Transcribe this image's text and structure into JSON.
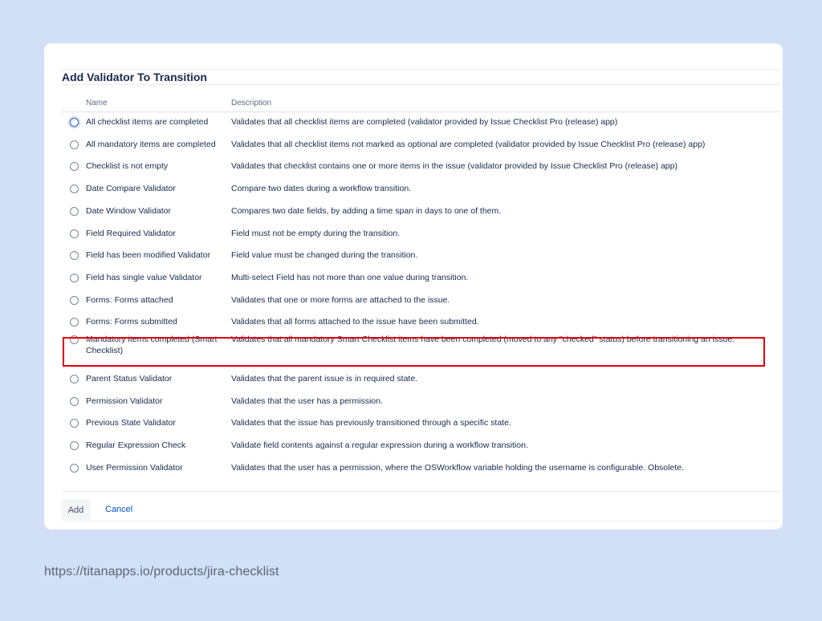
{
  "dialog": {
    "title": "Add Validator To Transition",
    "columns": {
      "name": "Name",
      "description": "Description"
    },
    "rows": [
      {
        "name": "All checklist items are completed",
        "description": "Validates that all checklist items are completed (validator provided by Issue Checklist Pro (release) app)"
      },
      {
        "name": "All mandatory items are completed",
        "description": "Validates that all checklist items not marked as optional are completed (validator provided by Issue Checklist Pro (release) app)"
      },
      {
        "name": "Checklist is not empty",
        "description": "Validates that checklist contains one or more items in the issue (validator provided by Issue Checklist Pro (release) app)"
      },
      {
        "name": "Date Compare Validator",
        "description": "Compare two dates during a workflow transition."
      },
      {
        "name": "Date Window Validator",
        "description": "Compares two date fields, by adding a time span in days to one of them."
      },
      {
        "name": "Field Required Validator",
        "description": "Field must not be empty during the transition."
      },
      {
        "name": "Field has been modified Validator",
        "description": "Field value must be changed during the transition."
      },
      {
        "name": "Field has single value Validator",
        "description": "Multi-select Field has not more than one value during transition."
      },
      {
        "name": "Forms: Forms attached",
        "description": "Validates that one or more forms are attached to the issue."
      },
      {
        "name": "Forms: Forms submitted",
        "description": "Validates that all forms attached to the issue have been submitted."
      },
      {
        "name": "Mandatory items completed (Smart Checklist)",
        "description": "Validates that all mandatory Smart Checklist items have been completed (moved to any \"checked\" status) before transitioning an issue."
      },
      {
        "name": "Parent Status Validator",
        "description": "Validates that the parent issue is in required state."
      },
      {
        "name": "Permission Validator",
        "description": "Validates that the user has a permission."
      },
      {
        "name": "Previous State Validator",
        "description": "Validates that the issue has previously transitioned through a specific state."
      },
      {
        "name": "Regular Expression Check",
        "description": "Validate field contents against a regular expression during a workflow transition."
      },
      {
        "name": "User Permission Validator",
        "description": "Validates that the user has a permission, where the OSWorkflow variable holding the username is configurable. Obsolete."
      }
    ],
    "focused_row": 0,
    "highlighted_row": 10,
    "buttons": {
      "add": "Add",
      "cancel": "Cancel"
    }
  },
  "source_url": "https://titanapps.io/products/jira-checklist",
  "colors": {
    "background": "#d1e0f7",
    "highlight": "#e0000b",
    "link": "#0052cc",
    "text": "#172b4d"
  }
}
